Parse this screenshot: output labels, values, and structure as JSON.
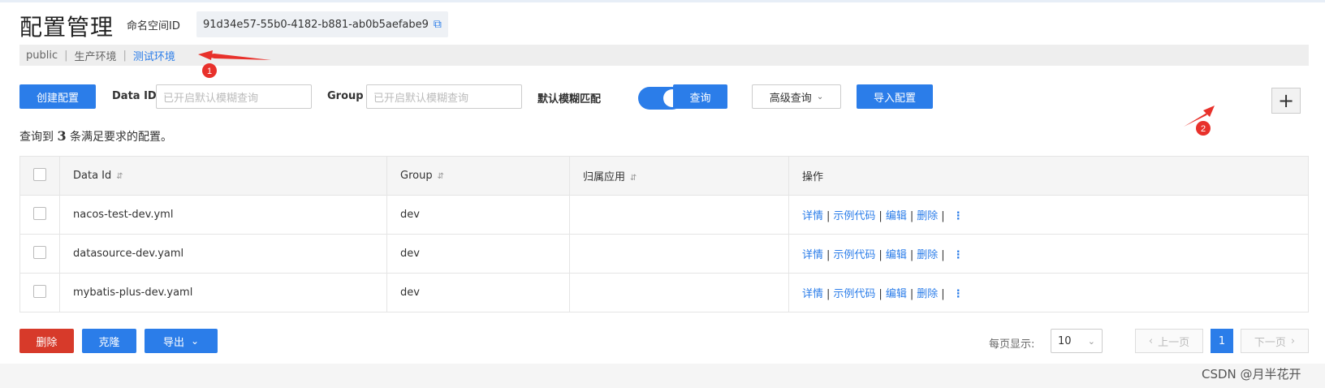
{
  "header": {
    "title": "配置管理",
    "namespace_label": "命名空间ID",
    "namespace_id": "91d34e57-55b0-4182-b881-ab0b5aefabe9"
  },
  "tabs": [
    {
      "label": "public"
    },
    {
      "label": "生产环境"
    },
    {
      "label": "测试环境",
      "active": true
    }
  ],
  "toolbar": {
    "create_label": "创建配置",
    "dataid_label": "Data ID",
    "dataid_placeholder": "已开启默认模糊查询",
    "group_label": "Group",
    "group_placeholder": "已开启默认模糊查询",
    "fuzzy_label": "默认模糊匹配",
    "fuzzy_on": true,
    "query_label": "查询",
    "advanced_label": "高级查询",
    "import_label": "导入配置",
    "plus_label": "+"
  },
  "result": {
    "prefix": "查询到",
    "count": "3",
    "suffix": "条满足要求的配置。"
  },
  "table": {
    "columns": [
      "Data Id",
      "Group",
      "归属应用",
      "操作"
    ],
    "rows": [
      {
        "dataid": "nacos-test-dev.yml",
        "group": "dev",
        "app": ""
      },
      {
        "dataid": "datasource-dev.yaml",
        "group": "dev",
        "app": ""
      },
      {
        "dataid": "mybatis-plus-dev.yaml",
        "group": "dev",
        "app": ""
      }
    ],
    "ops": [
      "详情",
      "示例代码",
      "编辑",
      "删除"
    ]
  },
  "bottom": {
    "delete_label": "删除",
    "clone_label": "克隆",
    "export_label": "导出"
  },
  "pager": {
    "per_page_label": "每页显示:",
    "per_page": "10",
    "prev": "上一页",
    "current": "1",
    "next": "下一页"
  },
  "annotations": {
    "one": "1",
    "two": "2",
    "arrow_color": "#e8312b"
  },
  "watermark": "CSDN @月半花开",
  "colors": {
    "primary": "#2b7de9",
    "danger": "#d73a2a"
  }
}
